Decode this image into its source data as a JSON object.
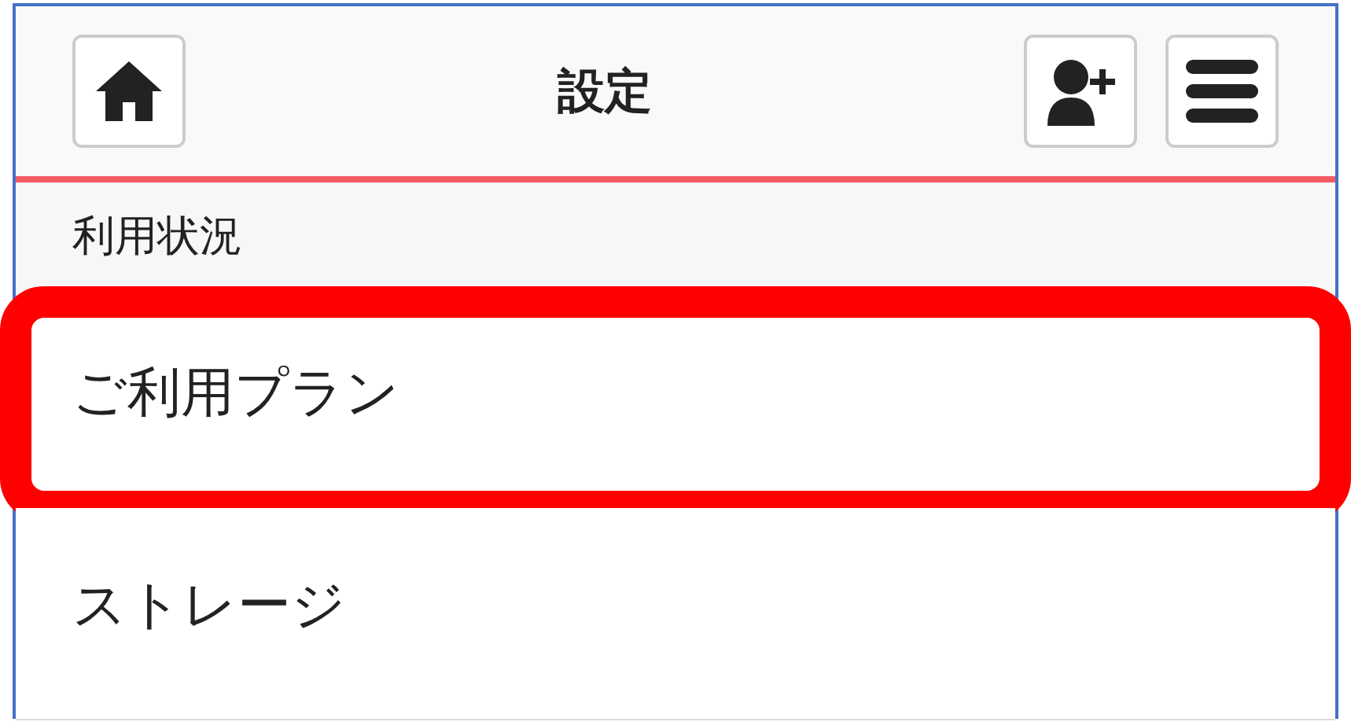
{
  "header": {
    "title": "設定"
  },
  "section": {
    "title": "利用状況"
  },
  "items": [
    {
      "label": "ご利用プラン",
      "highlighted": true
    },
    {
      "label": "ストレージ",
      "highlighted": false
    }
  ]
}
